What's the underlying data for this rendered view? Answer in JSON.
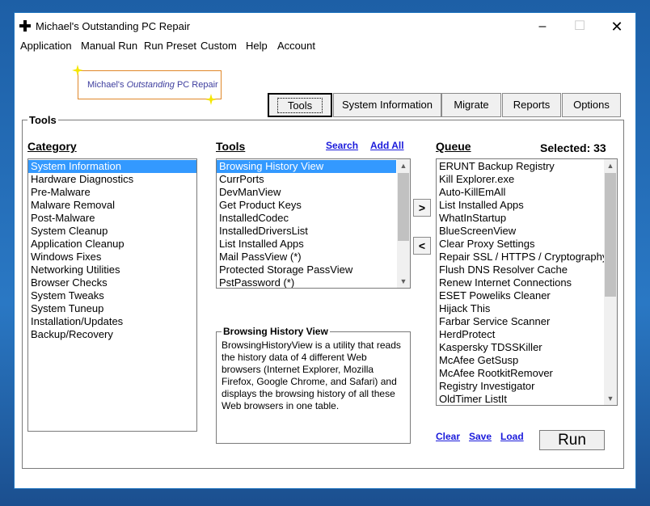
{
  "window": {
    "title": "Michael's Outstanding PC Repair",
    "minimize": "–",
    "maximize": "☐",
    "close": "✕"
  },
  "menu": [
    "Application",
    "Manual Run",
    "Run Preset",
    "Custom",
    "Help",
    "Account"
  ],
  "logo": {
    "prefix": "Michael's ",
    "italic": "Outstanding",
    "suffix": " PC Repair"
  },
  "tabs": [
    "Tools",
    "System Information",
    "Migrate",
    "Reports",
    "Options"
  ],
  "active_tab": "Tools",
  "group_label": "Tools",
  "category": {
    "heading": "Category",
    "items": [
      "System Information",
      "Hardware Diagnostics",
      "Pre-Malware",
      "Malware Removal",
      "Post-Malware",
      "System Cleanup",
      "Application Cleanup",
      "Windows Fixes",
      "Networking Utilities",
      "Browser Checks",
      "System Tweaks",
      "System Tuneup",
      "Installation/Updates",
      "Backup/Recovery"
    ],
    "selected": "System Information"
  },
  "tools": {
    "heading": "Tools",
    "search_link": "Search",
    "add_all_link": "Add All",
    "items": [
      "Browsing History View",
      "CurrPorts",
      "DevManView",
      "Get Product Keys",
      "InstalledCodec",
      "InstalledDriversList",
      "List Installed Apps",
      "Mail PassView (*)",
      "Protected Storage PassView",
      "PstPassword (*)"
    ],
    "selected": "Browsing History View"
  },
  "move_buttons": {
    "add": ">",
    "remove": "<"
  },
  "queue": {
    "heading": "Queue",
    "selected_label": "Selected: 33",
    "items": [
      "ERUNT Backup Registry",
      "Kill Explorer.exe",
      "Auto-KillEmAll",
      "List Installed Apps",
      "WhatInStartup",
      "BlueScreenView",
      "Clear Proxy Settings",
      "Repair SSL / HTTPS / Cryptography",
      "Flush DNS Resolver Cache",
      "Renew Internet Connections",
      "ESET Poweliks Cleaner",
      "Hijack This",
      "Farbar Service Scanner",
      "HerdProtect",
      "Kaspersky TDSSKiller",
      "McAfee GetSusp",
      "McAfee RootkitRemover",
      "Registry Investigator",
      "OldTimer ListIt"
    ],
    "clear_link": "Clear",
    "save_link": "Save",
    "load_link": "Load"
  },
  "description": {
    "title": "Browsing History View",
    "text": "BrowsingHistoryView is a utility that reads the history data of 4 different Web browsers (Internet Explorer, Mozilla Firefox, Google Chrome, and Safari) and displays the browsing history of all these Web browsers in one table."
  },
  "run_button": "Run",
  "scroll": {
    "up": "▲",
    "down": "▼"
  }
}
